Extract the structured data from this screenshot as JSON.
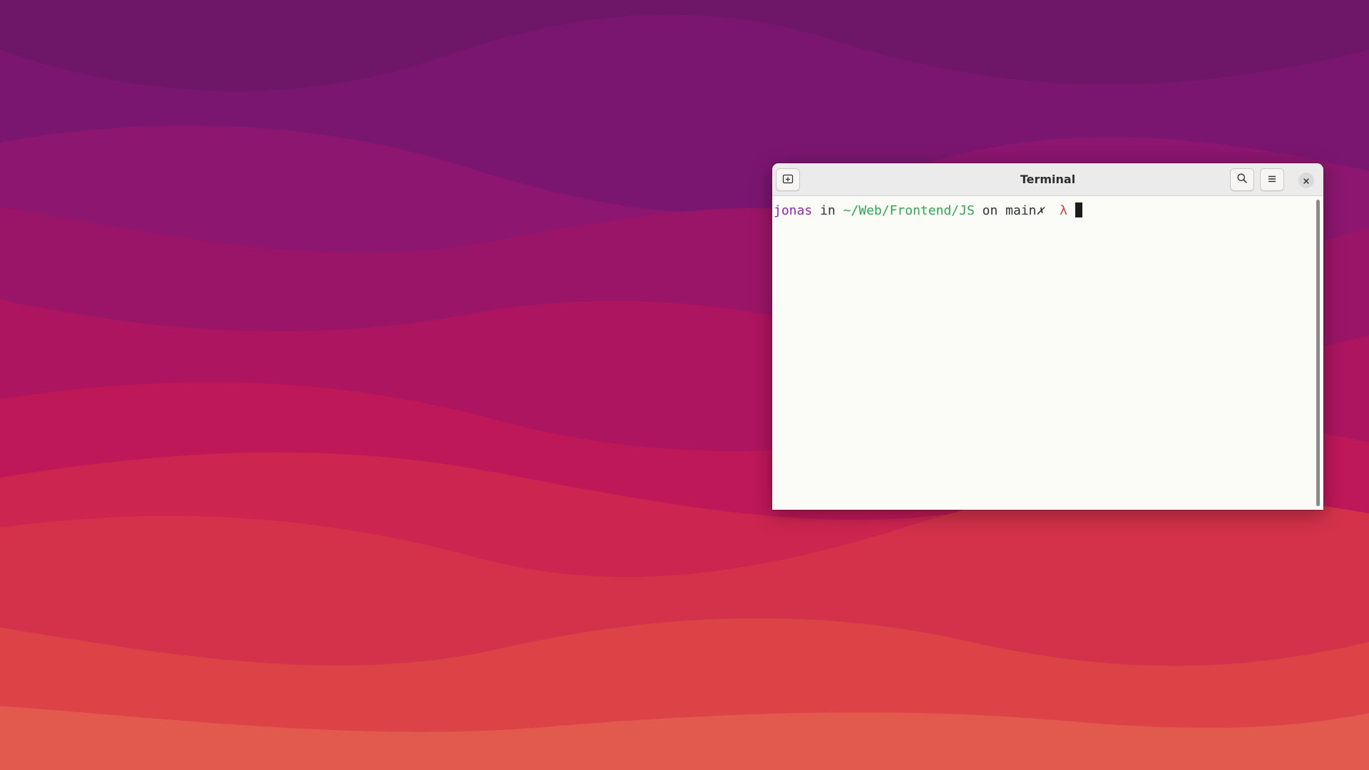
{
  "window": {
    "title": "Terminal"
  },
  "headerbar": {
    "new_tab_icon": "new-tab-icon",
    "search_icon": "search-icon",
    "menu_icon": "hamburger-menu-icon",
    "close_icon": "close-icon"
  },
  "prompt": {
    "user": "jonas",
    "in_word": "in",
    "path": "~/Web/Frontend/JS",
    "on_word": "on",
    "branch": "main",
    "dirty_marker": "✗",
    "symbol": "λ"
  },
  "colors": {
    "user": "#8a2bad",
    "path": "#2fa84f",
    "lambda": "#d93f3f",
    "wallpaper_top": "#6e1668",
    "wallpaper_bottom": "#e36a52"
  }
}
